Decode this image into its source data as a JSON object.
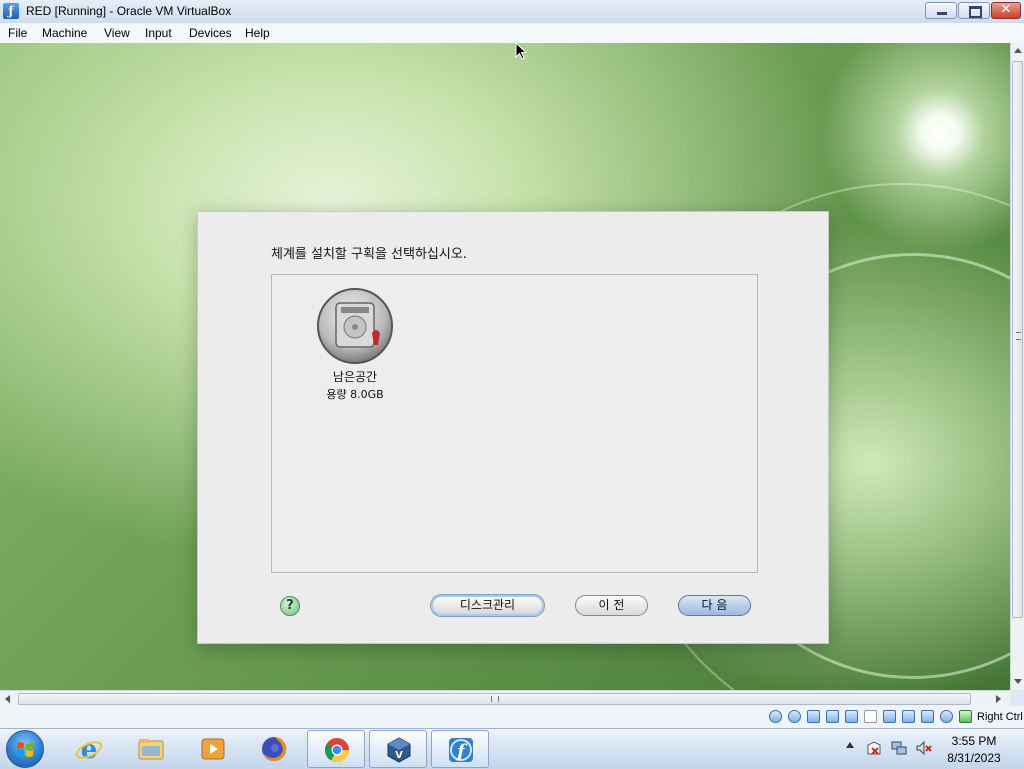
{
  "window": {
    "title": "RED [Running] - Oracle VM VirtualBox",
    "icon": "virtualbox-icon",
    "controls": [
      "minimize",
      "maximize",
      "close"
    ],
    "close_glyph": "✕"
  },
  "menu": {
    "items": [
      "File",
      "Machine",
      "View",
      "Input",
      "Devices",
      "Help"
    ]
  },
  "installer": {
    "heading": "체계를 설치할 구획을 선택하십시오.",
    "disk": {
      "name": "남은공간",
      "size": "용량 8.0GB",
      "icon": "hard-disk-icon"
    },
    "help_glyph": "?",
    "buttons": {
      "disk_management": "디스크관리",
      "previous": "이 전",
      "next": "다 음"
    }
  },
  "statusbar": {
    "icons": [
      "hard-disk-icon",
      "optical-drive-icon",
      "audio-icon",
      "network-icon",
      "usb-icon",
      "shared-folder-icon",
      "display-icon",
      "recording-icon",
      "virtualization-icon",
      "cpu-icon",
      "mouse-integration-icon"
    ],
    "host_key": "Right Ctrl"
  },
  "taskbar": {
    "items": [
      "internet-explorer-icon",
      "file-explorer-icon",
      "media-player-icon",
      "firefox-icon",
      "chrome-icon",
      "virtualbox-icon",
      "red-star-installer-icon"
    ],
    "active": [
      "chrome-icon",
      "virtualbox-icon",
      "red-star-installer-icon"
    ],
    "tray": [
      "show-hidden-icons-arrow",
      "action-center-icon",
      "network-icon",
      "volume-muted-icon"
    ],
    "clock_time": "3:55 PM",
    "clock_date": "8/31/2023"
  },
  "colors": {
    "wallpaper": "#6fa257",
    "dialog_bg": "#ececec",
    "next_button": "#9cb8de"
  }
}
